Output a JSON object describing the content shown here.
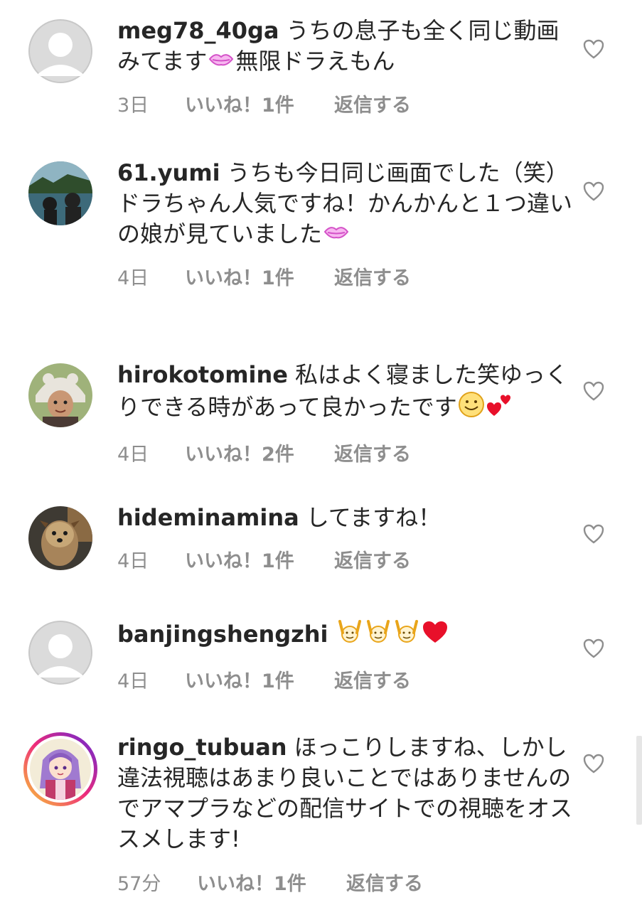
{
  "comments": [
    {
      "username": "meg78_40ga",
      "text": "うちの息子も全く同じ動画みてます",
      "text_after": "無限ドラえもん",
      "time": "3日",
      "likes": "いいね！1件",
      "reply": "返信する"
    },
    {
      "username": "61.yumi",
      "text": "うちも今日同じ画面でした（笑）",
      "line2": "ドラちゃん人気ですね！かんかんと１つ違いの娘が見ていました",
      "time": "4日",
      "likes": "いいね！1件",
      "reply": "返信する"
    },
    {
      "username": "hirokotomine",
      "text": "私はよく寝ました笑ゆっくりできる時があって良かったです",
      "time": "4日",
      "likes": "いいね！2件",
      "reply": "返信する"
    },
    {
      "username": "hideminamina",
      "text": "してますね！",
      "time": "4日",
      "likes": "いいね！1件",
      "reply": "返信する"
    },
    {
      "username": "banjingshengzhi",
      "text": "",
      "time": "4日",
      "likes": "いいね！1件",
      "reply": "返信する"
    },
    {
      "username": "ringo_tubuan",
      "text": "ほっこりしますね、しかし違法視聴はあまり良いことではありませんのでアマプラなどの配信サイトでの視聴をオススメします!",
      "time": "57分",
      "likes": "いいね！1件",
      "reply": "返信する"
    }
  ],
  "icons": {
    "like": "heart-outline-icon",
    "kiss": "kissing-lips-emoji",
    "smile": "smiling-face-emoji",
    "hearts": "two-hearts-emoji",
    "raised_hands": "raising-hands-emoji",
    "red_heart": "red-heart-emoji"
  },
  "colors": {
    "text": "#262626",
    "meta": "#8e8e8e",
    "heart_outline": "#8e8e8e"
  }
}
